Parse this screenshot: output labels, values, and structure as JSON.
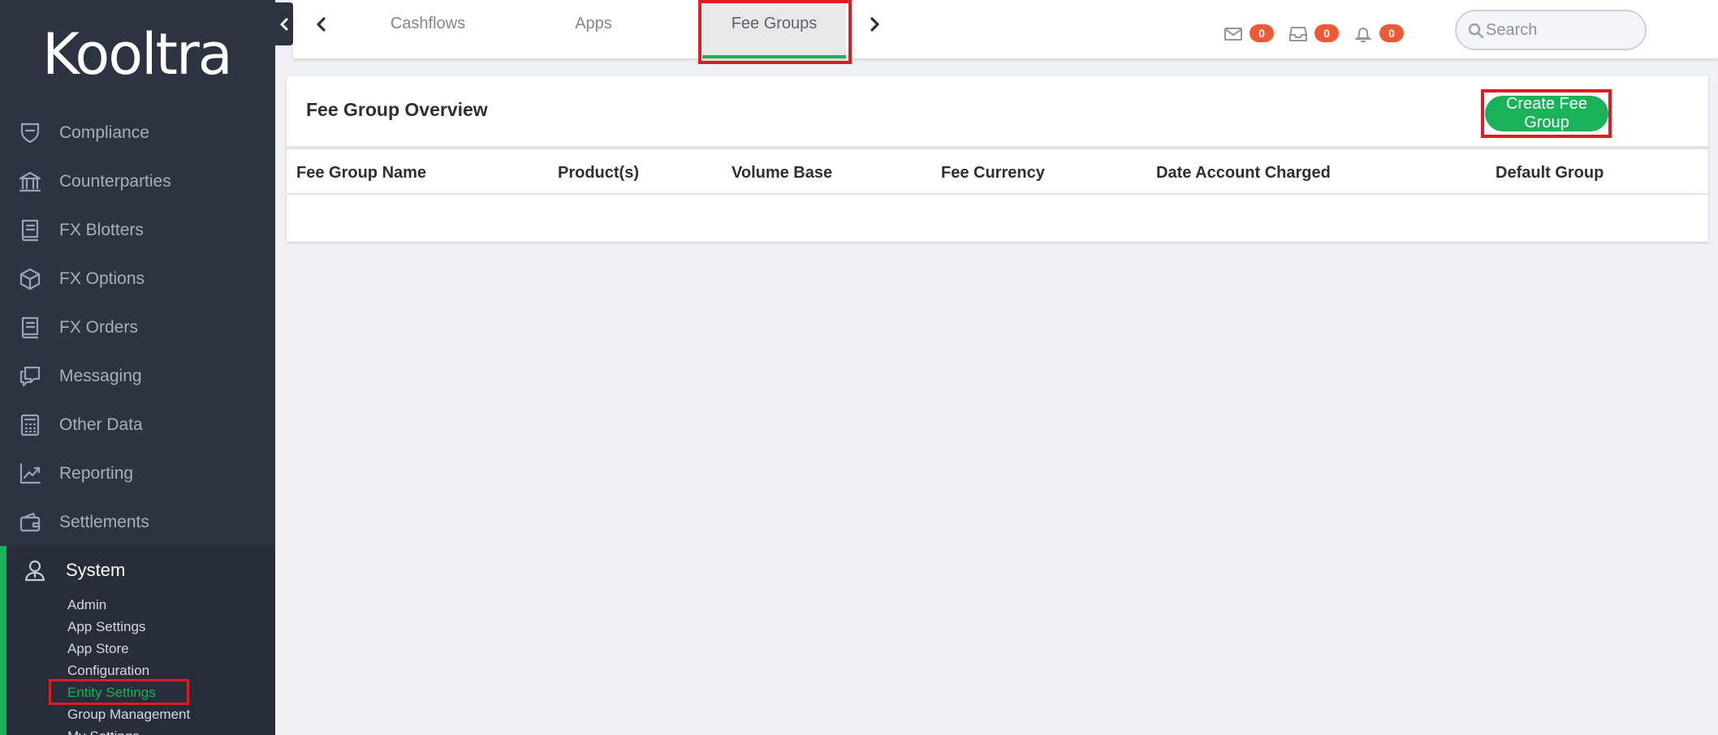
{
  "brand": {
    "logo_text": "Kooltra",
    "accent_color": "#1ab259",
    "sidebar_bg": "#2d3441",
    "badge_color": "#ee5a35",
    "highlight_color": "#e01b24"
  },
  "sidebar": {
    "items": [
      {
        "label": "Compliance",
        "icon": "shield-icon"
      },
      {
        "label": "Counterparties",
        "icon": "bank-icon"
      },
      {
        "label": "FX Blotters",
        "icon": "book-icon"
      },
      {
        "label": "FX Options",
        "icon": "cube-icon"
      },
      {
        "label": "FX Orders",
        "icon": "book-icon"
      },
      {
        "label": "Messaging",
        "icon": "chat-icon"
      },
      {
        "label": "Other Data",
        "icon": "calculator-icon"
      },
      {
        "label": "Reporting",
        "icon": "chart-line-icon"
      },
      {
        "label": "Settlements",
        "icon": "wallet-icon"
      }
    ],
    "system": {
      "label": "System",
      "icon": "user-icon",
      "sub_items": [
        {
          "label": "Admin"
        },
        {
          "label": "App Settings"
        },
        {
          "label": "App Store"
        },
        {
          "label": "Configuration"
        },
        {
          "label": "Entity Settings",
          "active": true
        },
        {
          "label": "Group Management"
        },
        {
          "label": "My Settings"
        }
      ]
    }
  },
  "topbar": {
    "tabs": [
      {
        "label": "Cashflows"
      },
      {
        "label": "Apps"
      },
      {
        "label": "Fee Groups",
        "active": true
      }
    ],
    "badges": {
      "mail": "0",
      "inbox": "0",
      "bell": "0"
    },
    "search": {
      "placeholder": "Search",
      "value": ""
    }
  },
  "main": {
    "title": "Fee Group Overview",
    "create_button": "Create Fee Group",
    "table": {
      "columns": [
        "Fee Group Name",
        "Product(s)",
        "Volume Base",
        "Fee Currency",
        "Date Account Charged",
        "Default Group"
      ],
      "rows": []
    }
  }
}
